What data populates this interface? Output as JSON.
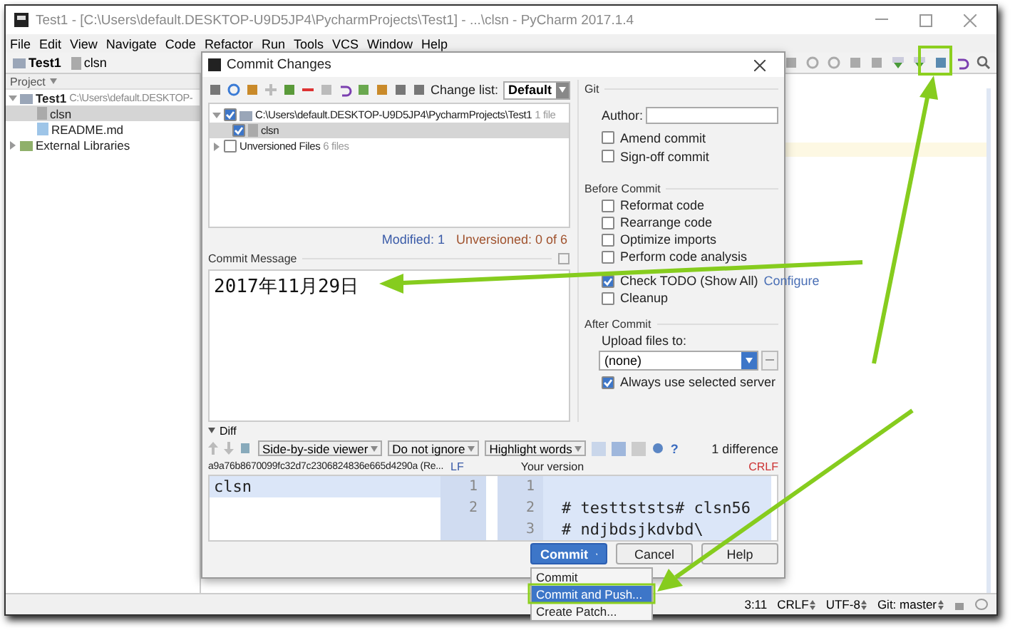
{
  "window": {
    "title": "Test1 - [C:\\Users\\default.DESKTOP-U9D5JP4\\PycharmProjects\\Test1] - ...\\clsn - PyCharm 2017.1.4"
  },
  "menu": [
    "File",
    "Edit",
    "View",
    "Navigate",
    "Code",
    "Refactor",
    "Run",
    "Tools",
    "VCS",
    "Window",
    "Help"
  ],
  "breadcrumb": [
    "Test1",
    "clsn"
  ],
  "project_panel": {
    "title": "Project",
    "tree": [
      {
        "name": "Test1",
        "path": "C:\\Users\\default.DESKTOP-",
        "kind": "folder",
        "expanded": true,
        "selected": false,
        "children": [
          {
            "name": "clsn",
            "kind": "file",
            "selected": true
          },
          {
            "name": "README.md",
            "kind": "markdown",
            "selected": false
          }
        ]
      },
      {
        "name": "External Libraries",
        "kind": "library",
        "expanded": false,
        "selected": false
      }
    ]
  },
  "dialog": {
    "title": "Commit Changes",
    "change_list": {
      "label": "Change list:",
      "value": "Default"
    },
    "changes": [
      {
        "label": "C:\\Users\\default.DESKTOP-U9D5JP4\\PycharmProjects\\Test1",
        "count": "1 file",
        "checked": true,
        "expanded": true,
        "selected": false,
        "children": [
          {
            "label": "clsn",
            "checked": true,
            "selected": true
          }
        ]
      },
      {
        "label": "Unversioned Files",
        "count": "6 files",
        "checked": false,
        "expanded": false,
        "selected": false
      }
    ],
    "summary": {
      "modified": "Modified: 1",
      "unversioned": "Unversioned: 0 of 6"
    },
    "commit_message": {
      "label": "Commit Message",
      "value": "2017年11月29日"
    },
    "git": {
      "title": "Git",
      "author_label": "Author:",
      "options": [
        {
          "label": "Amend commit",
          "checked": false
        },
        {
          "label": "Sign-off commit",
          "checked": false
        }
      ]
    },
    "before_commit": {
      "title": "Before Commit",
      "options": [
        {
          "label": "Reformat code",
          "checked": false
        },
        {
          "label": "Rearrange code",
          "checked": false
        },
        {
          "label": "Optimize imports",
          "checked": false
        },
        {
          "label": "Perform code analysis",
          "checked": false
        },
        {
          "label": "Check TODO (Show All)",
          "checked": true,
          "link": "Configure"
        },
        {
          "label": "Cleanup",
          "checked": false
        }
      ]
    },
    "after_commit": {
      "title": "After Commit",
      "upload_label": "Upload files to:",
      "server": "(none)",
      "always": {
        "label": "Always use selected server",
        "checked": true
      }
    },
    "diff": {
      "title": "Diff",
      "expanded": true,
      "viewer_options": [
        "Side-by-side viewer",
        "Do not ignore",
        "Highlight words"
      ],
      "help": "?",
      "difference_count": "1 difference",
      "left": {
        "title": "a9a76b8670099fc32d7c2306824836e665d4290a (Re...",
        "line_ending": "LF",
        "lines": [
          {
            "number": "1",
            "text": "clsn",
            "changed": true
          },
          {
            "number": "2",
            "changed": false
          }
        ]
      },
      "right": {
        "title": "Your version",
        "line_ending": "CRLF",
        "lines": [
          {
            "number": "1",
            "changed": true
          },
          {
            "number": "2",
            "text": "# testtststs# clsn56",
            "changed": true
          },
          {
            "number": "3",
            "text": "# ndjbdsjkdvbd\\",
            "changed": true
          }
        ]
      }
    },
    "buttons": [
      {
        "label": "Commit",
        "kind": "primary"
      },
      {
        "label": "Cancel",
        "kind": "normal"
      },
      {
        "label": "Help",
        "kind": "normal"
      }
    ],
    "commit_menu": [
      {
        "label": "Commit",
        "selected": false
      },
      {
        "label": "Commit and Push...",
        "selected": true
      },
      {
        "label": "Create Patch...",
        "selected": false
      }
    ]
  },
  "status_bar": [
    {
      "text": "3:11",
      "kind": "plain"
    },
    {
      "text": "CRLF",
      "kind": "menu"
    },
    {
      "text": "UTF-8",
      "kind": "menu"
    },
    {
      "text": "Git: master",
      "kind": "menu"
    }
  ]
}
